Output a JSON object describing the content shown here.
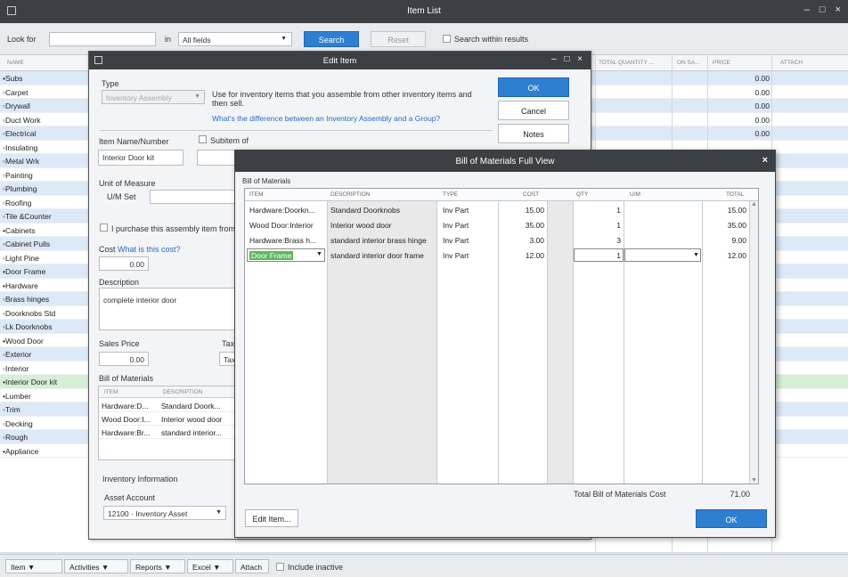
{
  "main": {
    "title": "Item List",
    "look_for_label": "Look for",
    "in_label": "in",
    "field_select": "All fields",
    "search_btn": "Search",
    "reset_btn": "Reset",
    "search_within": "Search within results"
  },
  "columns": {
    "name": "NAME",
    "total_qty": "TOTAL QUANTITY ...",
    "on_sales": "ON SA...",
    "price": "PRICE",
    "attach": "ATTACH"
  },
  "items": [
    {
      "name": "•Subs",
      "price": "0.00"
    },
    {
      "name": "◦Carpet",
      "price": "0.00"
    },
    {
      "name": "◦Drywall",
      "price": "0.00"
    },
    {
      "name": "◦Duct Work",
      "price": "0.00"
    },
    {
      "name": "◦Electrical",
      "price": "0.00"
    },
    {
      "name": "◦Insulating",
      "price": ""
    },
    {
      "name": "◦Metal Wrk",
      "price": ""
    },
    {
      "name": "◦Painting",
      "price": ""
    },
    {
      "name": "◦Plumbing",
      "price": ""
    },
    {
      "name": "◦Roofing",
      "price": ""
    },
    {
      "name": "◦Tile &Counter",
      "price": ""
    },
    {
      "name": "•Cabinets",
      "price": ""
    },
    {
      "name": "◦Cabinet Pulls",
      "price": ""
    },
    {
      "name": "◦Light Pine",
      "price": ""
    },
    {
      "name": "•Door Frame",
      "price": ""
    },
    {
      "name": "•Hardware",
      "price": ""
    },
    {
      "name": "◦Brass hinges",
      "price": ""
    },
    {
      "name": "◦Doorknobs Std",
      "price": ""
    },
    {
      "name": "◦Lk Doorknobs",
      "price": ""
    },
    {
      "name": "•Wood Door",
      "price": ""
    },
    {
      "name": "◦Exterior",
      "price": ""
    },
    {
      "name": "◦Interior",
      "price": ""
    },
    {
      "name": "•Interior Door kit",
      "price": ""
    },
    {
      "name": "•Lumber",
      "price": ""
    },
    {
      "name": "◦Trim",
      "price": ""
    },
    {
      "name": "◦Decking",
      "price": ""
    },
    {
      "name": "◦Rough",
      "price": ""
    },
    {
      "name": "•Appliance",
      "price": ""
    }
  ],
  "bottom_bar": {
    "item": "Item",
    "activities": "Activities",
    "reports": "Reports",
    "excel": "Excel",
    "attach": "Attach",
    "include_inactive": "Include inactive"
  },
  "edit_item": {
    "title": "Edit Item",
    "type_label": "Type",
    "type_value": "Inventory Assembly",
    "type_help": "Use for inventory items that you assemble from other inventory items and then sell.",
    "type_link": "What's the difference between an Inventory Assembly and a Group?",
    "ok": "OK",
    "cancel": "Cancel",
    "notes": "Notes",
    "name_label": "Item Name/Number",
    "name_value": "Interior Door kit",
    "subitem_label": "Subitem of",
    "uom_label": "Unit of Measure",
    "uom_set": "U/M Set",
    "purchase_chk": "I purchase this assembly item from",
    "cost_label": "Cost",
    "cost_link": "What is this cost?",
    "cost_value": "0.00",
    "desc_label": "Description",
    "desc_value": "complete interior door",
    "sales_price_label": "Sales Price",
    "sales_price_value": "0.00",
    "tax_label": "Tax",
    "tax_value": "Tax",
    "bom_label": "Bill of Materials",
    "bom_col_item": "ITEM",
    "bom_col_desc": "DESCRIPTION",
    "bom_rows": [
      {
        "item": "Hardware:D...",
        "desc": "Standard Doork..."
      },
      {
        "item": "Wood Door:I...",
        "desc": "Interior wood door"
      },
      {
        "item": "Hardware:Br...",
        "desc": "standard interior..."
      }
    ],
    "inv_info_label": "Inventory Information",
    "asset_account_label": "Asset Account",
    "asset_account_value": "12100 · Inventory Asset"
  },
  "bom": {
    "title": "Bill of Materials Full View",
    "section_label": "Bill of Materials",
    "col_item": "ITEM",
    "col_desc": "DESCRIPTION",
    "col_type": "TYPE",
    "col_cost": "COST",
    "col_qty": "QTY",
    "col_um": "U/M",
    "col_total": "TOTAL",
    "rows": [
      {
        "item": "Hardware:Doorkn...",
        "desc": "Standard Doorknobs",
        "type": "Inv Part",
        "cost": "15.00",
        "qty": "1",
        "total": "15.00"
      },
      {
        "item": "Wood Door:Interior",
        "desc": "Interior wood door",
        "type": "Inv Part",
        "cost": "35.00",
        "qty": "1",
        "total": "35.00"
      },
      {
        "item": "Hardware:Brass h...",
        "desc": "standard interior brass hinge",
        "type": "Inv Part",
        "cost": "3.00",
        "qty": "3",
        "total": "9.00"
      },
      {
        "item": "Door Frame",
        "desc": "standard interior door frame",
        "type": "Inv Part",
        "cost": "12.00",
        "qty": "1",
        "total": "12.00"
      }
    ],
    "total_label": "Total Bill of Materials Cost",
    "total_value": "71.00",
    "edit_btn": "Edit Item...",
    "ok_btn": "OK"
  },
  "colors": {
    "titlebar": "#3c3f43",
    "accent_blue": "#2f7fd1",
    "row_alt": "#dde9f6",
    "row_selected": "#d7efd4",
    "selected_cell": "#5cb85c"
  }
}
